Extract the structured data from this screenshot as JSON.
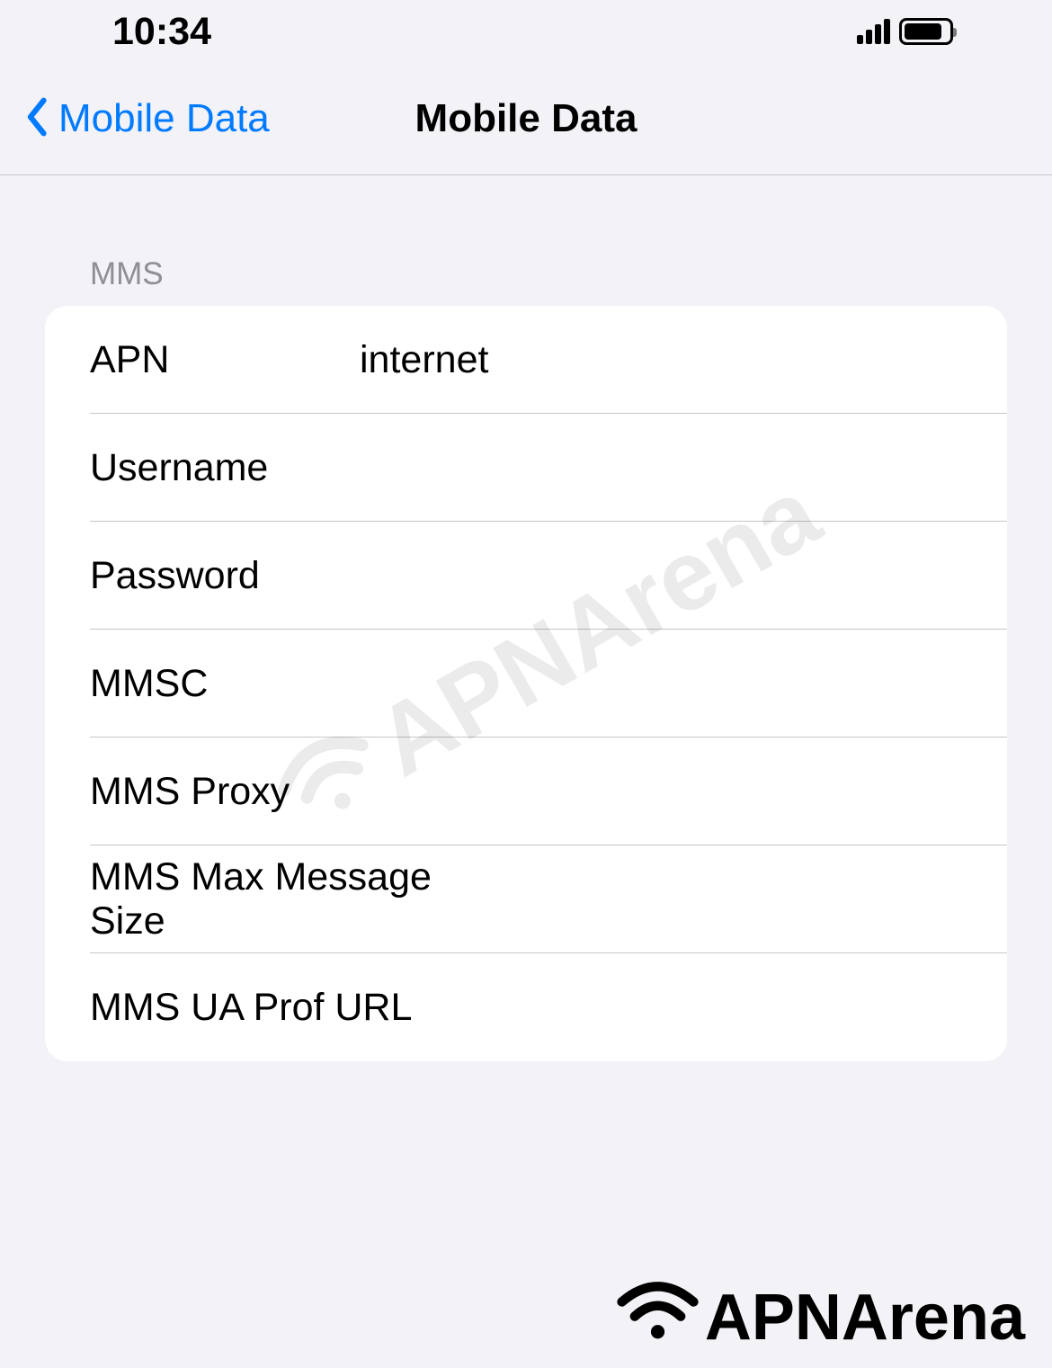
{
  "status_bar": {
    "time": "10:34"
  },
  "nav": {
    "back_label": "Mobile Data",
    "title": "Mobile Data"
  },
  "section": {
    "header": "MMS",
    "fields": {
      "apn": {
        "label": "APN",
        "value": "internet"
      },
      "username": {
        "label": "Username",
        "value": ""
      },
      "password": {
        "label": "Password",
        "value": ""
      },
      "mmsc": {
        "label": "MMSC",
        "value": ""
      },
      "mms_proxy": {
        "label": "MMS Proxy",
        "value": ""
      },
      "mms_max_size": {
        "label": "MMS Max Message Size",
        "value": ""
      },
      "mms_ua_prof_url": {
        "label": "MMS UA Prof URL",
        "value": ""
      }
    }
  },
  "watermark": {
    "text": "APNArena"
  },
  "footer": {
    "text": "APNArena"
  }
}
